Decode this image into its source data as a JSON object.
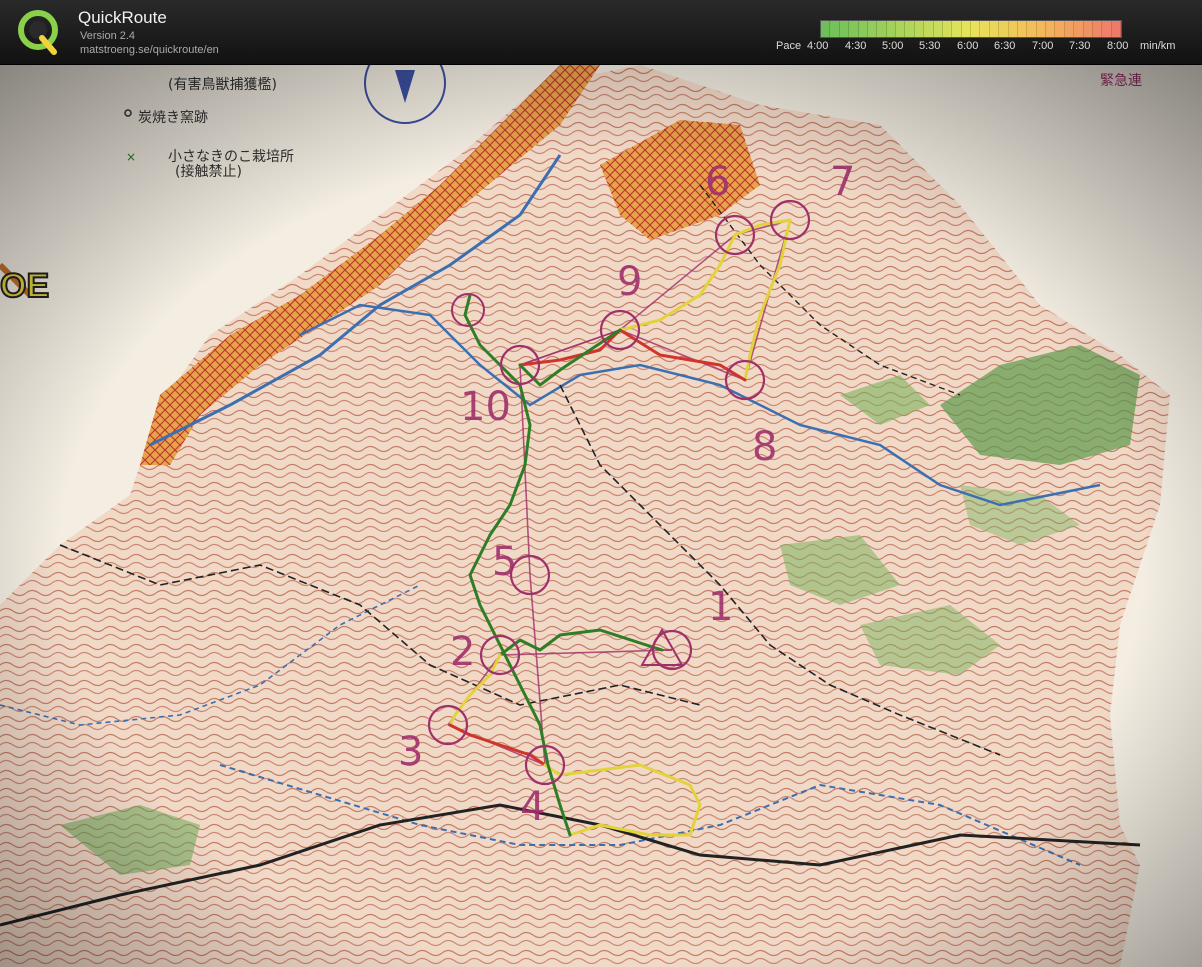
{
  "app": {
    "title": "QuickRoute",
    "version": "Version 2.4",
    "url": "matstroeng.se/quickroute/en"
  },
  "pace_legend": {
    "label": "Pace",
    "ticks": [
      "4:00",
      "4:30",
      "5:00",
      "5:30",
      "6:00",
      "6:30",
      "7:00",
      "7:30",
      "8:00"
    ],
    "unit": "min/km",
    "colors": [
      "#6cbf5a",
      "#a8d35a",
      "#e8e45a",
      "#f4b85a",
      "#ee7a6a"
    ]
  },
  "map": {
    "legend_text": [
      "(有害鳥獣捕獲檻)",
      "炭焼き窯跡",
      "小さなきのこ栽培所",
      "(接触禁止)"
    ],
    "corner_text": "緊急連",
    "course_controls": [
      "1",
      "2",
      "3",
      "4",
      "5",
      "6",
      "7",
      "8",
      "9",
      "10"
    ],
    "colors": {
      "paper": "#f3ede2",
      "contour": "#b4553a",
      "forest": "#5d9a4a",
      "settlement": "#e7a24c",
      "water": "#3b6fb0",
      "course": "#a0306a",
      "route_slow": "#d0342a",
      "route_mid": "#e3d33a",
      "route_fast": "#2f7d24"
    }
  }
}
